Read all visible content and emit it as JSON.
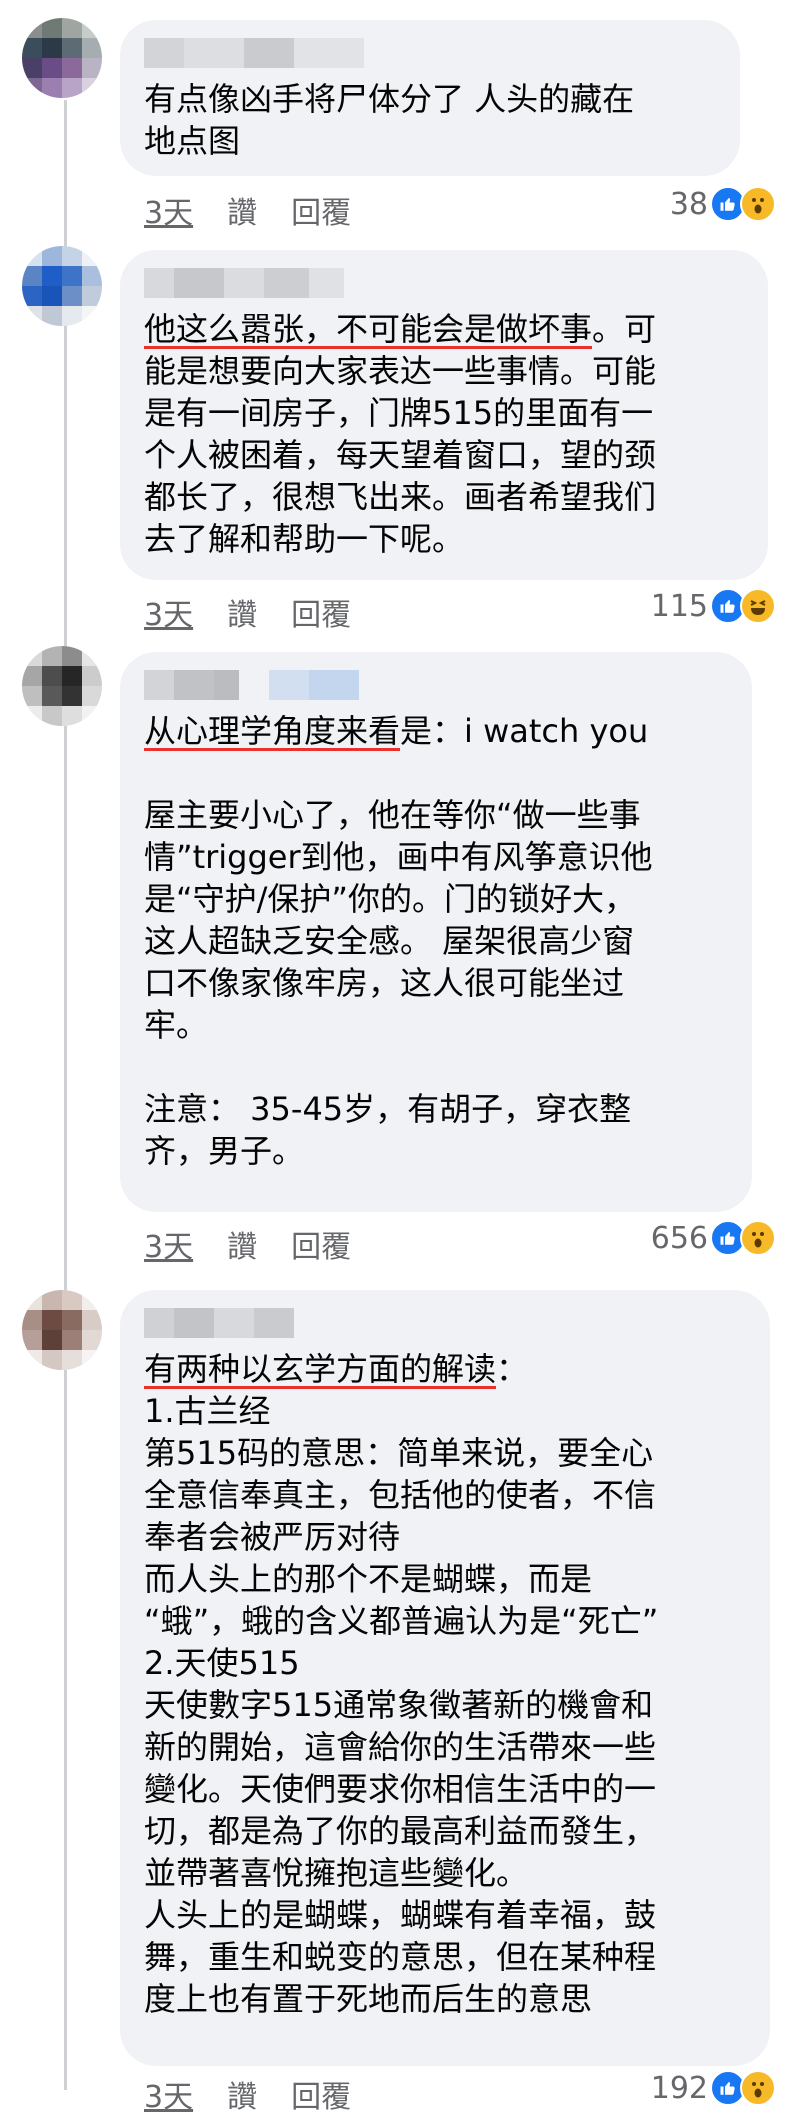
{
  "comments": [
    {
      "lines": [
        "有点像凶手将尸体分了 人头的藏在",
        "地点图"
      ],
      "time": "3天",
      "like_label": "讚",
      "reply_label": "回覆",
      "reaction_count": "38",
      "reactions": [
        "like-icon",
        "wow-icon"
      ]
    },
    {
      "first_underlined": "他这么嚣张，不可能会是做坏事",
      "first_rest": "。可",
      "lines": [
        "能是想要向大家表达一些事情。可能",
        "是有一间房子，门牌515的里面有一",
        "个人被困着，每天望着窗口，望的颈",
        "都长了，很想飞出来。画者希望我们",
        "去了解和帮助一下呢。"
      ],
      "time": "3天",
      "like_label": "讚",
      "reply_label": "回覆",
      "reaction_count": "115",
      "reactions": [
        "like-icon",
        "haha-icon"
      ]
    },
    {
      "first_underlined": "从心理学角度来看",
      "first_rest": "是：i watch you",
      "lines": [
        "",
        "屋主要小心了，他在等你“做一些事",
        "情”trigger到他，画中有风筝意识他",
        "是“守护/保护”你的。门的锁好大，",
        "这人超缺乏安全感。 屋架很高少窗",
        "口不像家像牢房，这人很可能坐过",
        "牢。",
        "",
        "注意： 35-45岁，有胡子，穿衣整",
        "齐，男子。"
      ],
      "time": "3天",
      "like_label": "讚",
      "reply_label": "回覆",
      "reaction_count": "656",
      "reactions": [
        "like-icon",
        "wow-icon"
      ]
    },
    {
      "first_underlined": "有两种以玄学方面的解读",
      "first_rest": "：",
      "lines": [
        "1.古兰经",
        "第515码的意思：简单来说，要全心",
        "全意信奉真主，包括他的使者，不信",
        "奉者会被严厉对待",
        "而人头上的那个不是蝴蝶，而是",
        "“蛾”，蛾的含义都普遍认为是“死亡”",
        "2.天使515",
        "天使數字515通常象徵著新的機會和",
        "新的開始，這會給你的生活帶來一些",
        "變化。天使們要求你相信生活中的一",
        "切，都是為了你的最高利益而發生，",
        "並帶著喜悅擁抱這些變化。",
        "人头上的是蝴蝶，蝴蝶有着幸福，鼓",
        "舞，重生和蜕变的意思，但在某种程",
        "度上也有置于死地而后生的意思"
      ],
      "time": "3天",
      "like_label": "讚",
      "reply_label": "回覆",
      "reaction_count": "192",
      "reactions": [
        "like-icon",
        "wow-icon"
      ]
    }
  ]
}
